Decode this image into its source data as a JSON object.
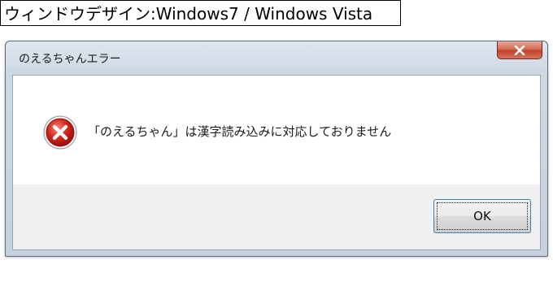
{
  "caption": {
    "text": "ウィンドウデザイン:Windows7 / Windows Vista"
  },
  "dialog": {
    "title": "のえるちゃんエラー",
    "message": "「のえるちゃん」は漢字読み込みに対応しておりません",
    "icon": "error-icon",
    "ok_label": "OK",
    "close_icon": "close-icon"
  },
  "colors": {
    "error_red": "#c41d1d",
    "close_red": "#c2412b",
    "focus_blue": "#3c7fb1"
  }
}
